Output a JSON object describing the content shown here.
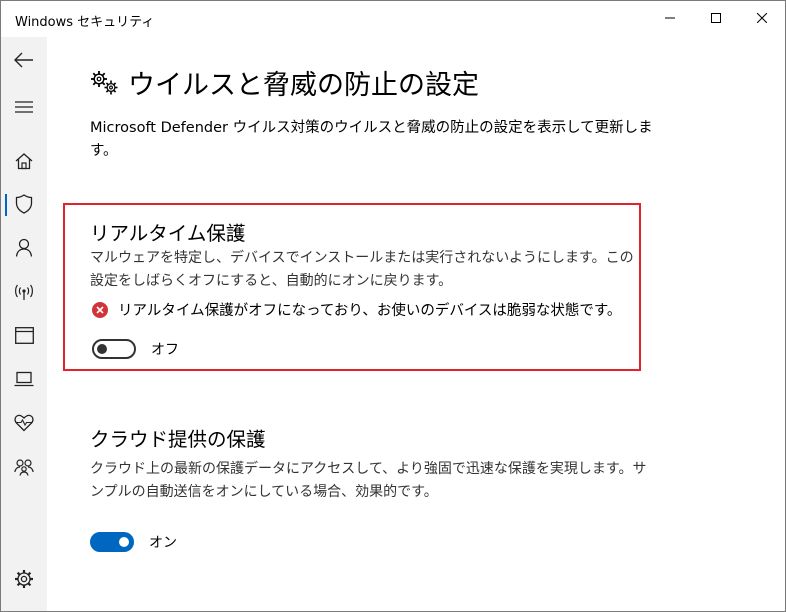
{
  "window": {
    "title": "Windows セキュリティ"
  },
  "sidebar": {
    "items": [
      {
        "icon": "back-arrow-icon"
      },
      {
        "icon": "hamburger-menu-icon"
      },
      {
        "icon": "home-icon"
      },
      {
        "icon": "shield-icon",
        "active": true
      },
      {
        "icon": "person-icon"
      },
      {
        "icon": "wireless-antenna-icon"
      },
      {
        "icon": "app-browser-window-icon"
      },
      {
        "icon": "laptop-icon"
      },
      {
        "icon": "heart-pulse-icon"
      },
      {
        "icon": "family-icon"
      },
      {
        "icon": "settings-gear-icon"
      }
    ]
  },
  "main": {
    "title": "ウイルスと脅威の防止の設定",
    "description": "Microsoft Defender ウイルス対策のウイルスと脅威の防止の設定を表示して更新します。",
    "realtime": {
      "title": "リアルタイム保護",
      "description": "マルウェアを特定し、デバイスでインストールまたは実行されないようにします。この設定をしばらくオフにすると、自動的にオンに戻ります。",
      "warning": "リアルタイム保護がオフになっており、お使いのデバイスは脆弱な状態です。",
      "toggle_state": false,
      "toggle_label": "オフ"
    },
    "cloud": {
      "title": "クラウド提供の保護",
      "description": "クラウド上の最新の保護データにアクセスして、より強固で迅速な保護を実現します。サンプルの自動送信をオンにしている場合、効果的です。",
      "toggle_state": true,
      "toggle_label": "オン"
    }
  },
  "colors": {
    "accent": "#0067c0",
    "highlight_border": "#e0242e",
    "error_icon": "#d13438",
    "sidebar_bg": "#f2f2f2"
  }
}
